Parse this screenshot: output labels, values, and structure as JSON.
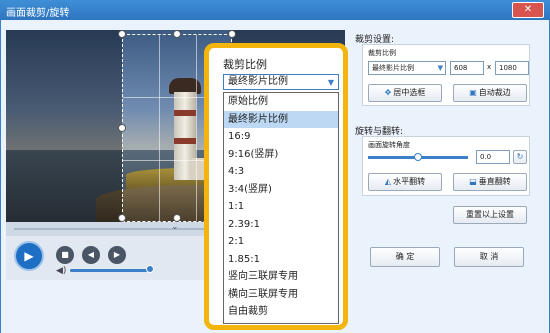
{
  "window": {
    "title": "画面裁剪/旋转",
    "close_label": "✕"
  },
  "player": {
    "play_icon": "play-icon",
    "stop_icon": "stop-icon",
    "prev_icon": "prev-frame-icon",
    "next_icon": "next-frame-icon",
    "volume_level": 0.82,
    "chevron": "⌄"
  },
  "crop_settings": {
    "section_title": "裁剪设置:",
    "ratio_label": "裁剪比例",
    "ratio_value": "最终影片比例",
    "width": "608",
    "times": "x",
    "height": "1080",
    "center_button": "居中选框",
    "auto_edge_button": "自动裁边"
  },
  "rotate_settings": {
    "section_title": "旋转与翻转:",
    "angle_label": "画面旋转角度",
    "angle_value": "0.0",
    "h_flip_button": "水平翻转",
    "v_flip_button": "垂直翻转",
    "reset_button": "重置以上设置"
  },
  "dialog_buttons": {
    "ok": "确  定",
    "cancel": "取  消"
  },
  "dropdown": {
    "label": "裁剪比例",
    "selected": "最终影片比例",
    "options": [
      "原始比例",
      "最终影片比例",
      "16:9",
      "9:16(竖屏)",
      "4:3",
      "3:4(竖屏)",
      "1:1",
      "2.39:1",
      "2:1",
      "1.85:1",
      "竖向三联屏专用",
      "横向三联屏专用",
      "自由裁剪"
    ],
    "highlighted_index": 1
  },
  "colors": {
    "accent": "#2f75bf",
    "highlight_border": "#f2b40d",
    "selected_row": "#bcd8f2"
  }
}
